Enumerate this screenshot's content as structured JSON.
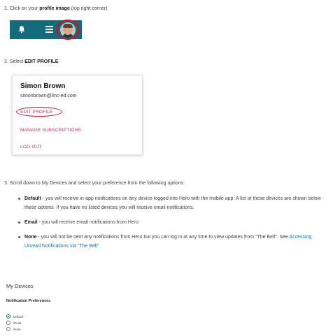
{
  "steps": {
    "s1_prefix": "1. Click on your ",
    "s1_bold": "profile image",
    "s1_suffix": " (top right corner)",
    "s2_prefix": "2. Select ",
    "s2_bold": "EDIT PROFILE",
    "s3": "3. Scroll down to My Devices and select your preference from the following options:"
  },
  "toolbar": {
    "bell_icon": "bell-icon",
    "menu_icon": "hamburger-menu-icon",
    "avatar": "profile-image",
    "bg_color": "#136b7e",
    "highlight_color": "#d0121c"
  },
  "profile_menu": {
    "name": "Simon Brown",
    "email": "simonbrown@linc-ed.com",
    "edit_profile": "EDIT PROFILE",
    "manage_subscriptions": "MANAGE SUBSCRIPTIONS",
    "log_out": "LOG OUT",
    "link_color": "#e0227a"
  },
  "options": {
    "default_label": "Default",
    "default_text": " - you will receive in-app notifications on any device logged into Hero with the mobile app. A list of these devices are shown below these options. If you have no listed devices you will receive email notifications.",
    "email_label": "Email",
    "email_text": " - you will receive email notifications from Hero",
    "none_label": "None",
    "none_text": " - you will not be sent any notifications from Hero but you can log in at any time to view updates from \"The Bell\". See ",
    "none_link": "Accessing Unread Notifications via \"The Bell\""
  },
  "devices": {
    "title": "My Devices",
    "pref_title": "Notification Preferences",
    "radios": [
      {
        "label": "Default",
        "selected": true
      },
      {
        "label": "Email",
        "selected": false
      },
      {
        "label": "None",
        "selected": false
      }
    ]
  }
}
